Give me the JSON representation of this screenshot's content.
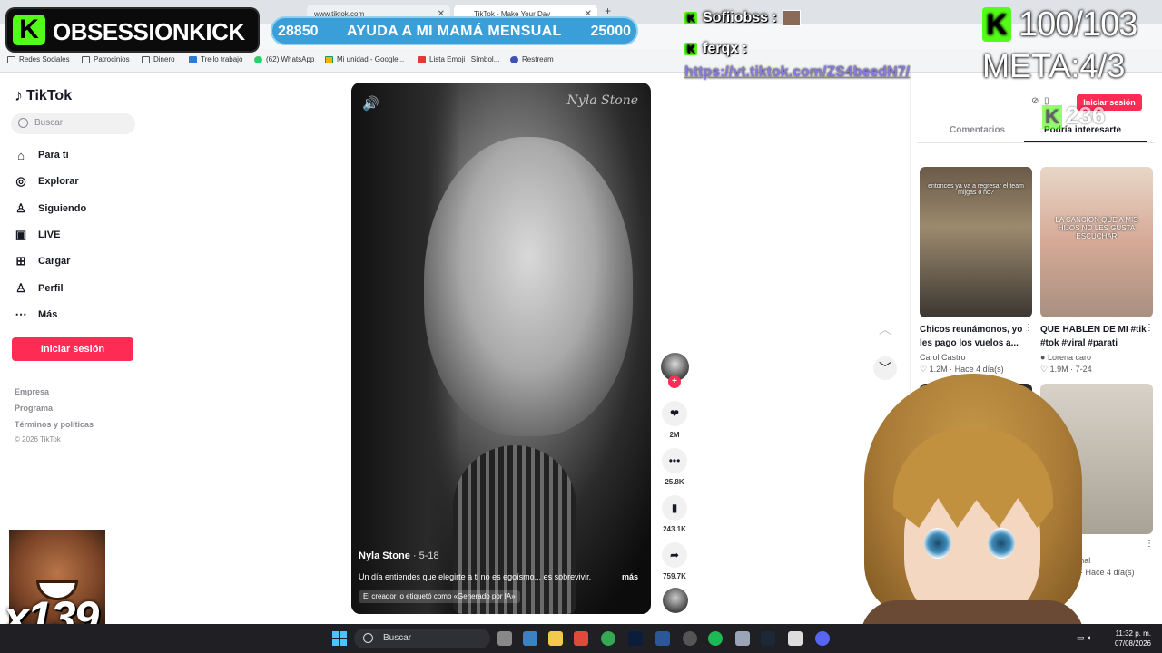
{
  "browser": {
    "tabs": [
      {
        "title": "www.tiktok.com"
      },
      {
        "title": "TikTok - Make Your Day"
      }
    ],
    "bookmarks": [
      "Redes Sociales",
      "Patrocinios",
      "Dinero",
      "Trello trabajo",
      "(62) WhatsApp",
      "Mi unidad - Google...",
      "Lista Emoji : Símbol...",
      "Restream"
    ]
  },
  "overlay": {
    "channel_name": "OBSESSIONKICK",
    "goal": {
      "current": "28850",
      "label": "AYUDA A MI MAMÁ MENSUAL",
      "target": "25000"
    },
    "chat": [
      {
        "user": "Sofiiobss :"
      },
      {
        "user": "ferqx :"
      }
    ],
    "chat_link": "https://vt.tiktok.com/ZS4beedN7/",
    "counter": "100/103",
    "meta": "META:4/3",
    "k_count": "236",
    "multiplier": "x139"
  },
  "tiktok": {
    "logo": "TikTok",
    "search_placeholder": "Buscar",
    "nav": [
      {
        "label": "Para ti",
        "icon": "home-icon"
      },
      {
        "label": "Explorar",
        "icon": "compass-icon"
      },
      {
        "label": "Siguiendo",
        "icon": "following-icon"
      },
      {
        "label": "LIVE",
        "icon": "live-icon"
      },
      {
        "label": "Cargar",
        "icon": "upload-icon"
      },
      {
        "label": "Perfil",
        "icon": "profile-icon"
      },
      {
        "label": "Más",
        "icon": "more-icon"
      }
    ],
    "login_label": "Iniciar sesión",
    "footer": [
      "Empresa",
      "Programa",
      "Términos y políticas"
    ],
    "copyright": "© 2026 TikTok",
    "video": {
      "author": "Nyla Stone",
      "date": " · 5-18",
      "description": "Un día entiendes que elegirte a ti no es egoísmo... es sobrevivir.",
      "more": "más",
      "ai_tag": "El creador lo etiquetó como «Generado por IA»",
      "signature": "Nyla Stone"
    },
    "actions": {
      "likes": "2M",
      "comments": "25.8K",
      "saves": "243.1K",
      "shares": "759.7K"
    },
    "right_panel": {
      "login_label": "Iniciar sesión",
      "tab_comments": "Comentarios",
      "tab_suggest": "Podría interesarte",
      "cards": [
        {
          "title": "Chicos reunámonos, yo les pago los vuelos a...",
          "author": "Carol Castro",
          "views": "1.2M",
          "when": "Hace 4 día(s)",
          "thumb_text": "entonces ya va a regresar el team mijgas o no?"
        },
        {
          "title": "QUE HABLEN DE MI #tik #tok #viral #parati",
          "author": "Lorena caro",
          "views": "1.9M",
          "when": "7-24",
          "thumb_text": "LA CANCION QUE A MIS HIJOS NO LES GUSTA ESCUCHAR"
        },
        {
          "title": "",
          "author": "'amal",
          "views": "M",
          "when": "Hace 4 día(s)"
        }
      ]
    }
  },
  "taskbar": {
    "search": "Buscar",
    "time": "11:32 p. m.",
    "date": "07/08/2026"
  }
}
